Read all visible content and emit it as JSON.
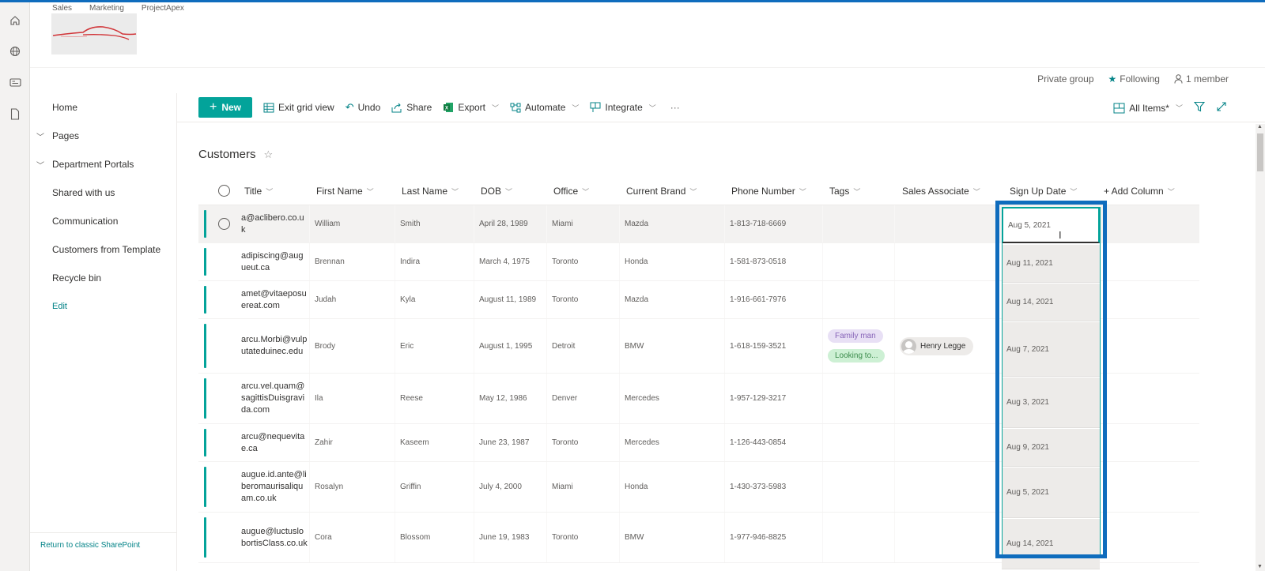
{
  "hub_nav": [
    "Sales",
    "Marketing",
    "ProjectApex"
  ],
  "group": {
    "privacy": "Private group",
    "following": "Following",
    "members": "1 member"
  },
  "left_nav": {
    "items": [
      {
        "label": "Home",
        "expandable": false
      },
      {
        "label": "Pages",
        "expandable": true
      },
      {
        "label": "Department Portals",
        "expandable": true
      },
      {
        "label": "Shared with us",
        "expandable": false
      },
      {
        "label": "Communication",
        "expandable": false
      },
      {
        "label": "Customers from Template",
        "expandable": false
      },
      {
        "label": "Recycle bin",
        "expandable": false
      }
    ],
    "edit": "Edit",
    "footer": "Return to classic SharePoint"
  },
  "command_bar": {
    "new": "New",
    "exit_grid": "Exit grid view",
    "undo": "Undo",
    "share": "Share",
    "export": "Export",
    "automate": "Automate",
    "integrate": "Integrate",
    "more": "···",
    "view": "All Items*"
  },
  "list": {
    "title": "Customers",
    "columns": [
      "Title",
      "First Name",
      "Last Name",
      "DOB",
      "Office",
      "Current Brand",
      "Phone Number",
      "Tags",
      "Sales Associate",
      "Sign Up Date",
      "+ Add Column"
    ],
    "rows": [
      {
        "title": "a@aclibero.co.uk",
        "first": "William",
        "last": "Smith",
        "dob": "April 28, 1989",
        "office": "Miami",
        "brand": "Mazda",
        "phone": "1-813-718-6669",
        "tags": [],
        "associate": "",
        "signup": "Aug 5, 2021"
      },
      {
        "title": "adipiscing@augueut.ca",
        "first": "Brennan",
        "last": "Indira",
        "dob": "March 4, 1975",
        "office": "Toronto",
        "brand": "Honda",
        "phone": "1-581-873-0518",
        "tags": [],
        "associate": "",
        "signup": "Aug 11, 2021"
      },
      {
        "title": "amet@vitaeposuereat.com",
        "first": "Judah",
        "last": "Kyla",
        "dob": "August 11, 1989",
        "office": "Toronto",
        "brand": "Mazda",
        "phone": "1-916-661-7976",
        "tags": [],
        "associate": "",
        "signup": "Aug 14, 2021"
      },
      {
        "title": "arcu.Morbi@vulputateduinec.edu",
        "first": "Brody",
        "last": "Eric",
        "dob": "August 1, 1995",
        "office": "Detroit",
        "brand": "BMW",
        "phone": "1-618-159-3521",
        "tags": [
          "Family man",
          "Looking to..."
        ],
        "associate": "Henry Legge",
        "signup": "Aug 7, 2021"
      },
      {
        "title": "arcu.vel.quam@sagittisDuisgravida.com",
        "first": "Ila",
        "last": "Reese",
        "dob": "May 12, 1986",
        "office": "Denver",
        "brand": "Mercedes",
        "phone": "1-957-129-3217",
        "tags": [],
        "associate": "",
        "signup": "Aug 3, 2021"
      },
      {
        "title": "arcu@nequevitae.ca",
        "first": "Zahir",
        "last": "Kaseem",
        "dob": "June 23, 1987",
        "office": "Toronto",
        "brand": "Mercedes",
        "phone": "1-126-443-0854",
        "tags": [],
        "associate": "",
        "signup": "Aug 9, 2021"
      },
      {
        "title": "augue.id.ante@liberomaurisaliquam.co.uk",
        "first": "Rosalyn",
        "last": "Griffin",
        "dob": "July 4, 2000",
        "office": "Miami",
        "brand": "Honda",
        "phone": "1-430-373-5983",
        "tags": [],
        "associate": "",
        "signup": "Aug 5, 2021"
      },
      {
        "title": "augue@luctuslobortisClass.co.uk",
        "first": "Cora",
        "last": "Blossom",
        "dob": "June 19, 1983",
        "office": "Toronto",
        "brand": "BMW",
        "phone": "1-977-946-8825",
        "tags": [],
        "associate": "",
        "signup": "Aug 14, 2021"
      }
    ]
  },
  "colors": {
    "accent": "#03a39a",
    "selection": "#0f6cbd"
  }
}
